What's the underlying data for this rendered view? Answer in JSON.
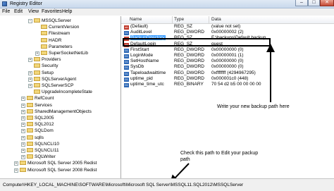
{
  "window": {
    "title": "Registry Editor",
    "min": "–",
    "max": "□",
    "close": "✕"
  },
  "menu": [
    "File",
    "Edit",
    "View",
    "Favorites",
    "Help"
  ],
  "tree": [
    {
      "label": "MSSQLServer",
      "expanded": true,
      "indent": 3
    },
    {
      "label": "CurrentVersion",
      "indent": 4
    },
    {
      "label": "Filestream",
      "indent": 4
    },
    {
      "label": "HADR",
      "indent": 4
    },
    {
      "label": "Parameters",
      "indent": 4
    },
    {
      "label": "SuperSocketNetLib",
      "indent": 4,
      "collapsed": true
    },
    {
      "label": "Providers",
      "indent": 3,
      "collapsed": true
    },
    {
      "label": "Security",
      "indent": 3
    },
    {
      "label": "Setup",
      "indent": 3,
      "collapsed": true
    },
    {
      "label": "SQLServerAgent",
      "indent": 3,
      "collapsed": true
    },
    {
      "label": "SQLServerSCP",
      "indent": 3,
      "collapsed": true
    },
    {
      "label": "UpgradeIncompleteState",
      "indent": 3
    },
    {
      "label": "RefCount",
      "indent": 2,
      "collapsed": true
    },
    {
      "label": "Services",
      "indent": 2,
      "collapsed": true
    },
    {
      "label": "SharedManagementObjects",
      "indent": 2,
      "collapsed": true
    },
    {
      "label": "SQL2005",
      "indent": 2,
      "collapsed": true
    },
    {
      "label": "SQL2012",
      "indent": 2,
      "collapsed": true
    },
    {
      "label": "SQLDom",
      "indent": 2,
      "collapsed": true
    },
    {
      "label": "sqlls",
      "indent": 2,
      "collapsed": true
    },
    {
      "label": "SQLNCLI10",
      "indent": 2,
      "collapsed": true
    },
    {
      "label": "SQLNCLI11",
      "indent": 2,
      "collapsed": true
    },
    {
      "label": "SQLWriter",
      "indent": 2,
      "collapsed": true
    },
    {
      "label": "Microsoft SQL Server 2005 Redist",
      "indent": 1,
      "collapsed": true
    },
    {
      "label": "Microsoft SQL Server 2008 Redist",
      "indent": 1,
      "collapsed": true
    }
  ],
  "columns": {
    "name": "Name",
    "type": "Type",
    "data": "Data"
  },
  "values": [
    {
      "icon": "ab",
      "name": "(Default)",
      "type": "REG_SZ",
      "data": "(value not set)"
    },
    {
      "icon": "bin",
      "name": "AuditLevel",
      "type": "REG_DWORD",
      "data": "0x00000002 (2)"
    },
    {
      "icon": "ab",
      "name": "BackupDirectory",
      "type": "REG_SZ",
      "data": "E:\\backups\\Default backup",
      "selected": true
    },
    {
      "icon": "ab",
      "name": "DefaultLogin",
      "type": "REG_SZ",
      "data": "guest"
    },
    {
      "icon": "bin",
      "name": "FirstStart",
      "type": "REG_DWORD",
      "data": "0x00000000 (0)"
    },
    {
      "icon": "bin",
      "name": "LoginMode",
      "type": "REG_DWORD",
      "data": "0x00000001 (1)"
    },
    {
      "icon": "bin",
      "name": "SetHostName",
      "type": "REG_DWORD",
      "data": "0x00000000 (0)"
    },
    {
      "icon": "bin",
      "name": "SysDb",
      "type": "REG_DWORD",
      "data": "0x00000000 (0)"
    },
    {
      "icon": "bin",
      "name": "Tapeloadwaittime",
      "type": "REG_DWORD",
      "data": "0xffffffff (4294967295)"
    },
    {
      "icon": "bin",
      "name": "uptime_pid",
      "type": "REG_DWORD",
      "data": "0x000001c0 (448)"
    },
    {
      "icon": "bin",
      "name": "uptime_time_utc",
      "type": "REG_BINARY",
      "data": "70 54 d2 b5 00 00 00 00"
    }
  ],
  "annotations": {
    "backup": "Write your new backup path here",
    "check_path": "Check this path to Edit your packup path"
  },
  "status": {
    "path": "Computer\\HKEY_LOCAL_MACHINE\\SOFTWARE\\Microsoft\\Microsoft SQL Server\\MSSQL11.SQL2012\\MSSQLServer"
  }
}
